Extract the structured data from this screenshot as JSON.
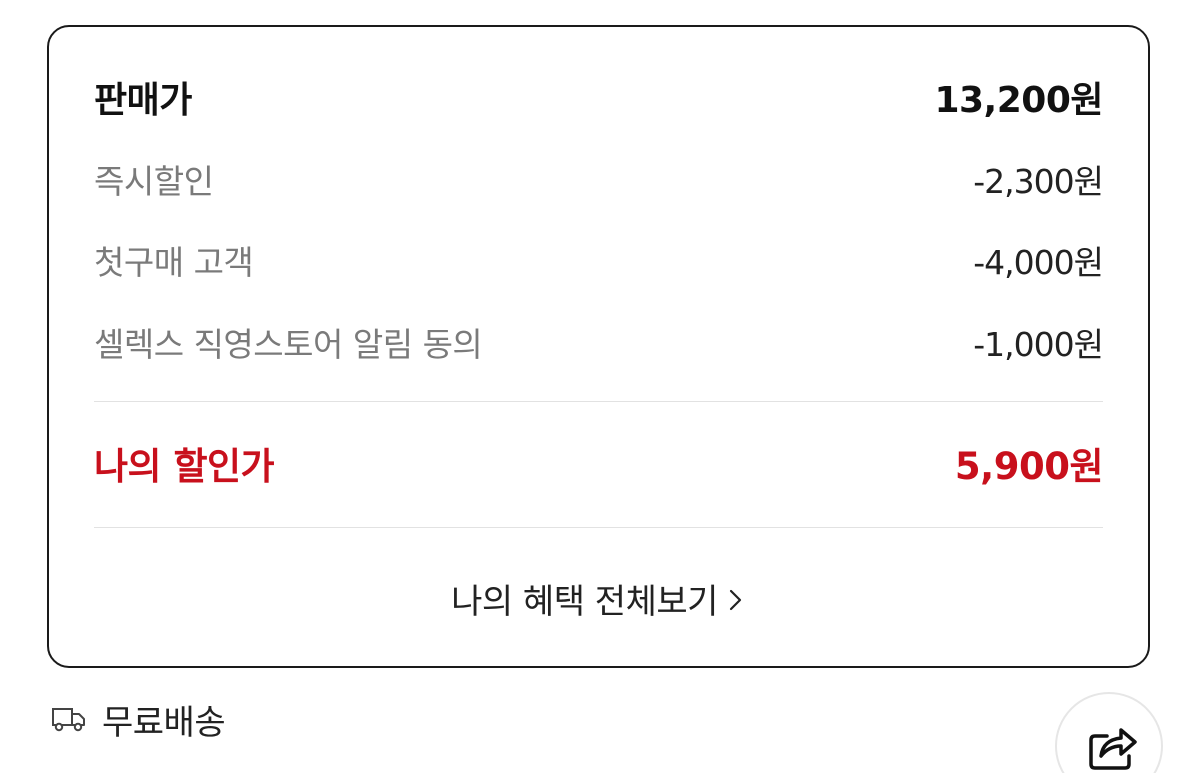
{
  "price_card": {
    "sale_price": {
      "label": "판매가",
      "value": "13,200원"
    },
    "discounts": [
      {
        "label": "즉시할인",
        "value": "-2,300원"
      },
      {
        "label": "첫구매 고객",
        "value": "-4,000원"
      },
      {
        "label": "셀렉스 직영스토어 알림 동의",
        "value": "-1,000원"
      }
    ],
    "final_price": {
      "label": "나의 할인가",
      "value": "5,900원"
    },
    "benefits_link": {
      "label": "나의 혜택 전체보기",
      "icon": "chevron-right-icon"
    }
  },
  "shipping": {
    "label": "무료배송",
    "icon": "truck-icon"
  },
  "share_button": {
    "icon": "share-icon"
  },
  "colors": {
    "accent_red": "#c8101c",
    "text_dark": "#111111",
    "text_gray": "#7a7a7a",
    "border": "#1a1a1a",
    "divider": "#e2e2e2"
  }
}
